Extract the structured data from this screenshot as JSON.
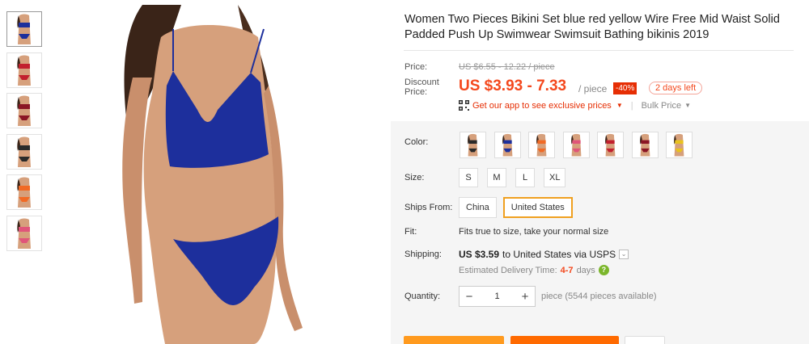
{
  "product": {
    "title": "Women Two Pieces Bikini Set blue red yellow Wire Free Mid Waist Solid Padded Push Up Swimwear Swimsuit Bathing bikinis 2019"
  },
  "thumbnails": [
    {
      "top": "#1d2f9c",
      "bottom": "#1d2f9c"
    },
    {
      "top": "#c2202e",
      "bottom": "#c2202e"
    },
    {
      "top": "#8b1525",
      "bottom": "#8b1525"
    },
    {
      "top": "#2a2a2a",
      "bottom": "#2a2a2a"
    },
    {
      "top": "#f16a25",
      "bottom": "#f16a25"
    },
    {
      "top": "#e0557a",
      "bottom": "#e0557a"
    }
  ],
  "price": {
    "label": "Price:",
    "original": "US $6.55 - 12.22 / piece",
    "discount_label": "Discount\nPrice:",
    "current": "US $3.93 - 7.33",
    "unit": "/ piece",
    "discount_pct": "-40%",
    "days_left": "2 days left",
    "app_promo": "Get our app to see exclusive prices",
    "bulk": "Bulk Price"
  },
  "options": {
    "color_label": "Color:",
    "colors": [
      {
        "name": "black",
        "color": "#2a2a2a"
      },
      {
        "name": "blue",
        "color": "#1d2f9c"
      },
      {
        "name": "orange",
        "color": "#f16a25"
      },
      {
        "name": "pink",
        "color": "#e0557a"
      },
      {
        "name": "red",
        "color": "#c2202e"
      },
      {
        "name": "wine",
        "color": "#8b1525"
      },
      {
        "name": "yellow",
        "color": "#e9c21e"
      }
    ],
    "size_label": "Size:",
    "sizes": [
      "S",
      "M",
      "L",
      "XL"
    ],
    "ships_label": "Ships From:",
    "ships_from": [
      "China",
      "United States"
    ],
    "ships_selected": "United States",
    "fit_label": "Fit:",
    "fit_text": "Fits true to size, take your normal size",
    "shipping_label": "Shipping:",
    "shipping_cost": "US $3.59",
    "shipping_dest": "to United States via USPS",
    "delivery_label": "Estimated Delivery Time:",
    "delivery_days": "4-7",
    "delivery_unit": "days",
    "quantity_label": "Quantity:",
    "quantity": "1",
    "available": "piece (5544 pieces available)"
  },
  "colors": {
    "accent": "#f4481d",
    "discount_bg": "#e62e04",
    "selected_border": "#f0a020",
    "buy_now": "#ff9a1e",
    "add_cart": "#ff6a00"
  }
}
